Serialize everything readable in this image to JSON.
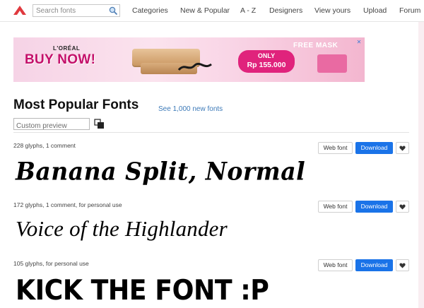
{
  "header": {
    "search_placeholder": "Search fonts",
    "nav": [
      "Categories",
      "New & Popular",
      "A - Z",
      "Designers",
      "View yours",
      "Upload",
      "Forum"
    ],
    "icons": {
      "logo": "dafont-logo-icon",
      "search": "search-icon"
    }
  },
  "ad": {
    "brand": "L'ORÉAL",
    "headline": "BUY NOW!",
    "only": "ONLY",
    "price": "Rp 155.000",
    "mask": "FREE MASK",
    "close": "✕",
    "colors": {
      "accent": "#e0237c",
      "headline": "#c4106a"
    }
  },
  "main": {
    "title": "Most Popular Fonts",
    "new_link": "See 1,000 new fonts",
    "preview_placeholder": "Custom preview",
    "accent_color": "#1a73e8"
  },
  "fonts": [
    {
      "meta": "228 glyphs, 1 comment",
      "sample": "Banana Split, Normal",
      "web_label": "Web font",
      "download_label": "Download"
    },
    {
      "meta": "172 glyphs, 1 comment, for personal use",
      "sample": "Voice of the Highlander",
      "web_label": "Web font",
      "download_label": "Download"
    },
    {
      "meta": "105 glyphs, for personal use",
      "sample": "KICK THE FONT :P",
      "web_label": "Web font",
      "download_label": "Download"
    }
  ]
}
